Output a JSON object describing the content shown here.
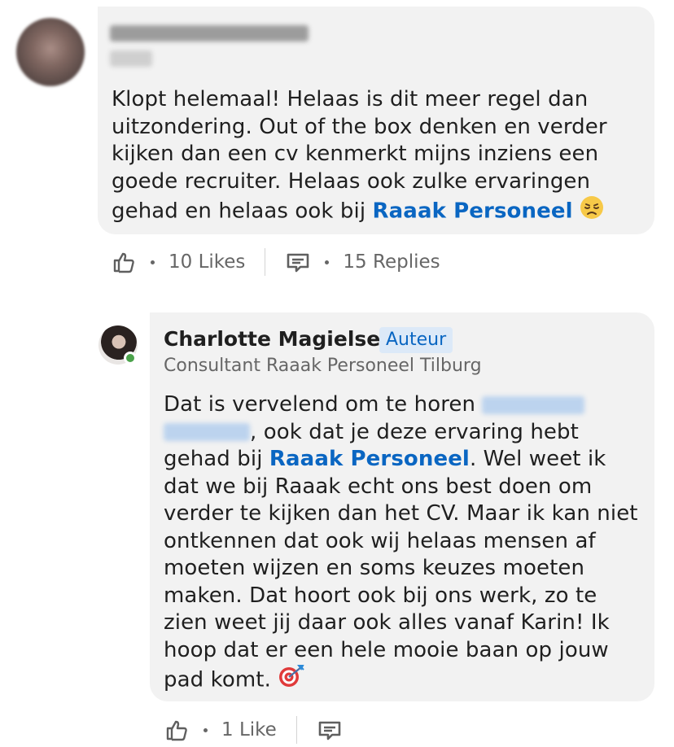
{
  "comments": [
    {
      "author_name_redacted": true,
      "text_main": "Klopt helemaal! Helaas is dit meer regel dan uitzondering. Out of the box denken en verder kijken dan een cv kenmerkt mijns inziens een goede recruiter. Helaas ook zulke ervaringen gehad en helaas ook bij ",
      "mention": "Raaak Personeel",
      "emoji_icon": "disappointed-face-icon",
      "likes_label": "10 Likes",
      "replies_label": "15 Replies"
    },
    {
      "author_name": "Charlotte Magielse",
      "badge": "Auteur",
      "headline": "Consultant Raaak Personeel Tilburg",
      "text_part1": "Dat is vervelend om te horen ",
      "text_part2": ", ook dat je deze ervaring hebt gehad bij ",
      "mention": "Raaak Personeel",
      "text_part3": ". Wel weet ik dat we bij Raaak echt ons best doen om verder te kijken dan het CV. Maar ik kan niet ontkennen dat ook wij helaas mensen af moeten wijzen en soms keuzes moeten maken. Dat hoort ook bij ons werk, zo te zien weet jij daar ook alles vanaf Karin! Ik hoop dat er een hele mooie baan op jouw pad komt. ",
      "emoji_icon": "direct-hit-target-icon",
      "likes_label": "1 Like"
    }
  ],
  "colors": {
    "link": "#0a66c2",
    "bubble": "#f2f2f2",
    "muted": "#666666",
    "online": "#4aa24a"
  }
}
